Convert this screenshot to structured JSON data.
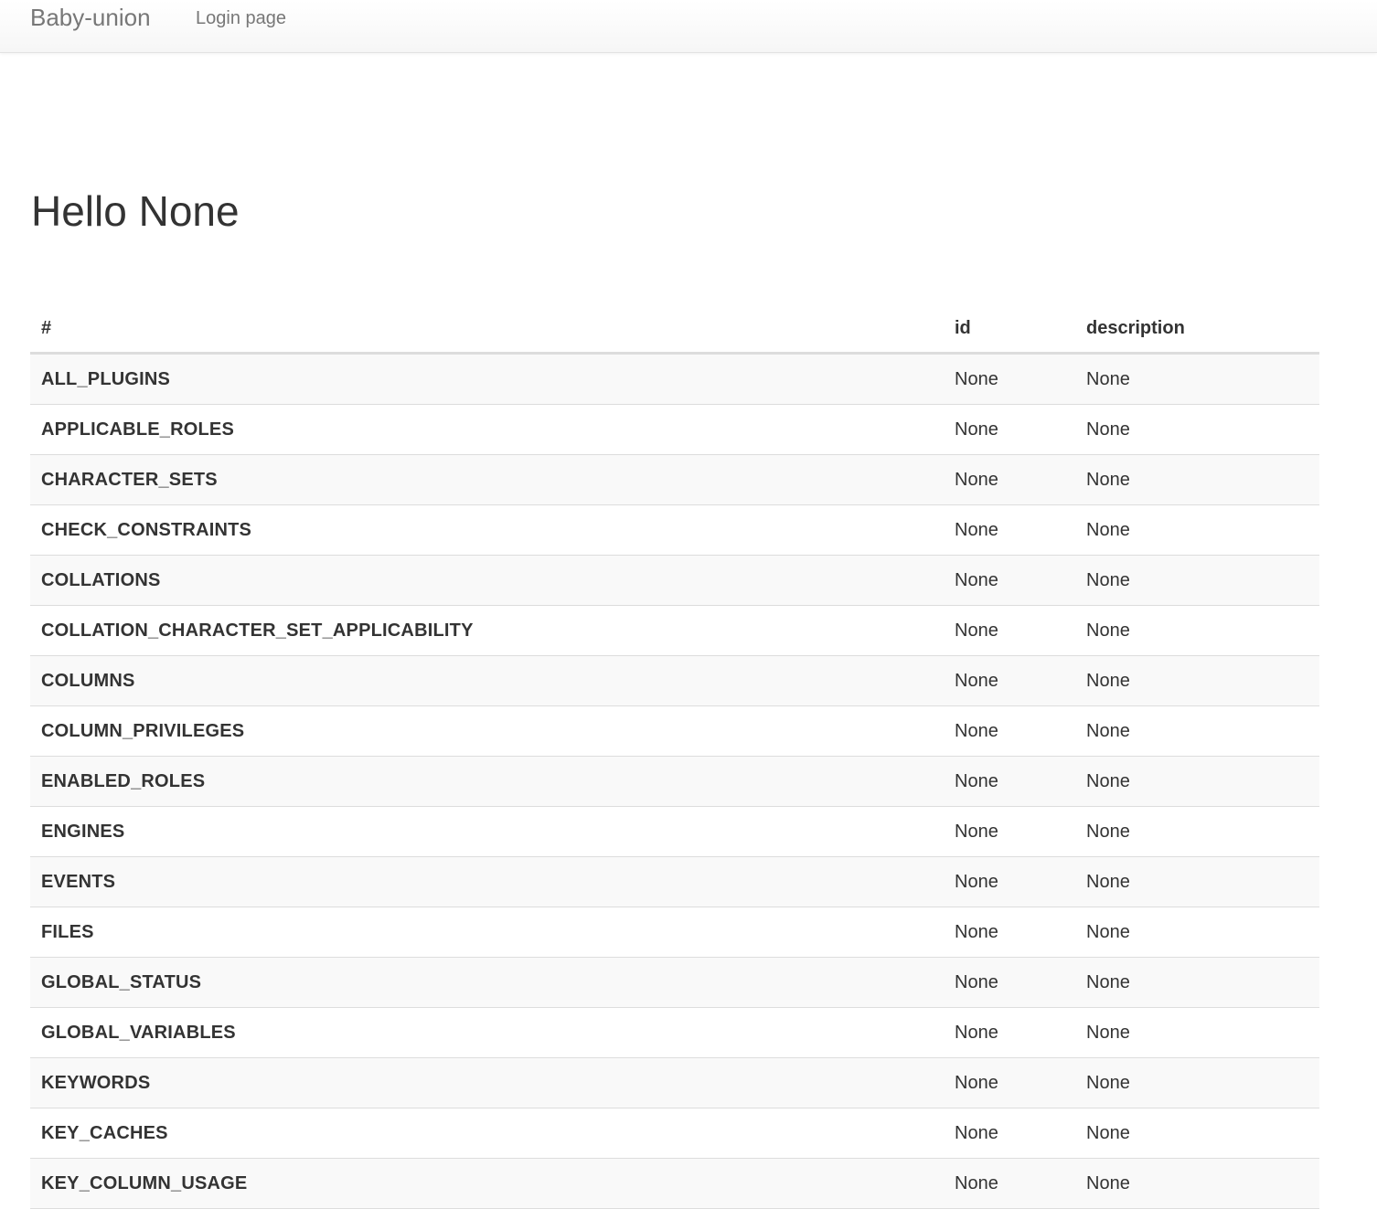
{
  "navbar": {
    "brand": "Baby-union",
    "link": "Login page"
  },
  "page": {
    "heading": "Hello None"
  },
  "table": {
    "headers": [
      "#",
      "id",
      "description"
    ],
    "rows": [
      {
        "name": "ALL_PLUGINS",
        "id": "None",
        "description": "None"
      },
      {
        "name": "APPLICABLE_ROLES",
        "id": "None",
        "description": "None"
      },
      {
        "name": "CHARACTER_SETS",
        "id": "None",
        "description": "None"
      },
      {
        "name": "CHECK_CONSTRAINTS",
        "id": "None",
        "description": "None"
      },
      {
        "name": "COLLATIONS",
        "id": "None",
        "description": "None"
      },
      {
        "name": "COLLATION_CHARACTER_SET_APPLICABILITY",
        "id": "None",
        "description": "None"
      },
      {
        "name": "COLUMNS",
        "id": "None",
        "description": "None"
      },
      {
        "name": "COLUMN_PRIVILEGES",
        "id": "None",
        "description": "None"
      },
      {
        "name": "ENABLED_ROLES",
        "id": "None",
        "description": "None"
      },
      {
        "name": "ENGINES",
        "id": "None",
        "description": "None"
      },
      {
        "name": "EVENTS",
        "id": "None",
        "description": "None"
      },
      {
        "name": "FILES",
        "id": "None",
        "description": "None"
      },
      {
        "name": "GLOBAL_STATUS",
        "id": "None",
        "description": "None"
      },
      {
        "name": "GLOBAL_VARIABLES",
        "id": "None",
        "description": "None"
      },
      {
        "name": "KEYWORDS",
        "id": "None",
        "description": "None"
      },
      {
        "name": "KEY_CACHES",
        "id": "None",
        "description": "None"
      },
      {
        "name": "KEY_COLUMN_USAGE",
        "id": "None",
        "description": "None"
      }
    ]
  }
}
